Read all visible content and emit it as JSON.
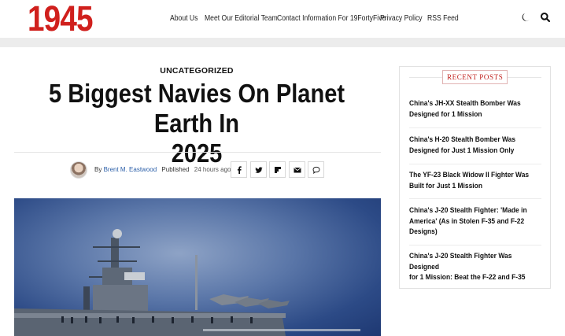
{
  "header": {
    "logo": "1945",
    "nav": [
      "About Us",
      "Meet Our Editorial Team",
      "Contact Information For 19FortyFive",
      "Privacy Policy",
      "RSS Feed"
    ],
    "icons": [
      "moon-icon",
      "search-icon"
    ]
  },
  "article": {
    "category": "UNCATEGORIZED",
    "title_line1": "5 Biggest Navies On Planet Earth In",
    "title_line2": "2025",
    "byline_by": "By",
    "author": "Brent M. Eastwood",
    "published_label": "Published",
    "published_ago": "24 hours ago",
    "share_icons": [
      "facebook-icon",
      "twitter-icon",
      "flipboard-icon",
      "email-icon",
      "comment-icon"
    ]
  },
  "sidebar": {
    "heading": "RECENT POSTS",
    "posts": [
      [
        "China's JH-XX Stealth Bomber Was",
        "Designed for 1 Mission"
      ],
      [
        "China's H-20 Stealth Bomber Was",
        "Designed for Just 1 Mission Only"
      ],
      [
        "The YF-23 Black Widow II Fighter Was",
        "Built for Just 1 Mission"
      ],
      [
        "China's J-20 Stealth Fighter: 'Made in",
        "America' (As in Stolen F-35 and F-22",
        "Designs)"
      ],
      [
        "China's J-20 Stealth Fighter Was Designed",
        "for 1 Mission: Beat the F-22 and F-35"
      ]
    ]
  },
  "colors": {
    "brand": "#d0201d",
    "link": "#2a5ea8"
  }
}
